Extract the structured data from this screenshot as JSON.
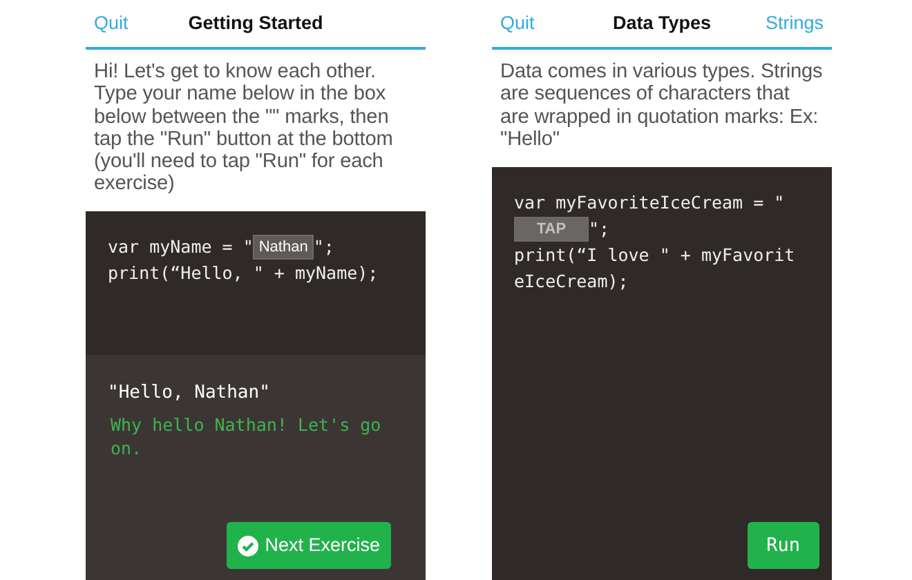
{
  "screens": [
    {
      "header": {
        "left_link": "Quit",
        "title": "Getting Started"
      },
      "description": "Hi! Let's get to know each other. Type your name below in the box below between the \"\" marks, then tap the \"Run\" button at the bottom (you'll need to tap \"Run\" for each exercise)",
      "code_lines": [
        [
          {
            "kind": "text",
            "text": "var myName = \""
          },
          {
            "kind": "field",
            "value": "Nathan"
          },
          {
            "kind": "text",
            "text": "\";"
          }
        ],
        [
          {
            "kind": "text",
            "text": "print(“Hello, \" + myName);"
          }
        ]
      ],
      "output": {
        "result": "\"Hello, Nathan\"",
        "message": "Why hello Nathan! Let's go on."
      },
      "button": {
        "label": "Next Exercise",
        "kind": "next"
      }
    },
    {
      "header": {
        "left_link": "Quit",
        "title": "Data Types",
        "right_link": "Strings"
      },
      "description": "Data comes in various types. Strings are sequences of characters that are wrapped in quotation marks: Ex: \"Hello\"",
      "code_lines": [
        [
          {
            "kind": "text",
            "text": "var myFavoriteIceCream = \""
          }
        ],
        [
          {
            "kind": "field",
            "placeholder": "TAP"
          },
          {
            "kind": "text",
            "text": "\";"
          }
        ],
        [
          {
            "kind": "text",
            "text": "print(“I love \" + myFavorit"
          }
        ],
        [
          {
            "kind": "text",
            "text": "eIceCream);"
          }
        ]
      ],
      "button": {
        "label": "Run",
        "kind": "run"
      }
    }
  ]
}
